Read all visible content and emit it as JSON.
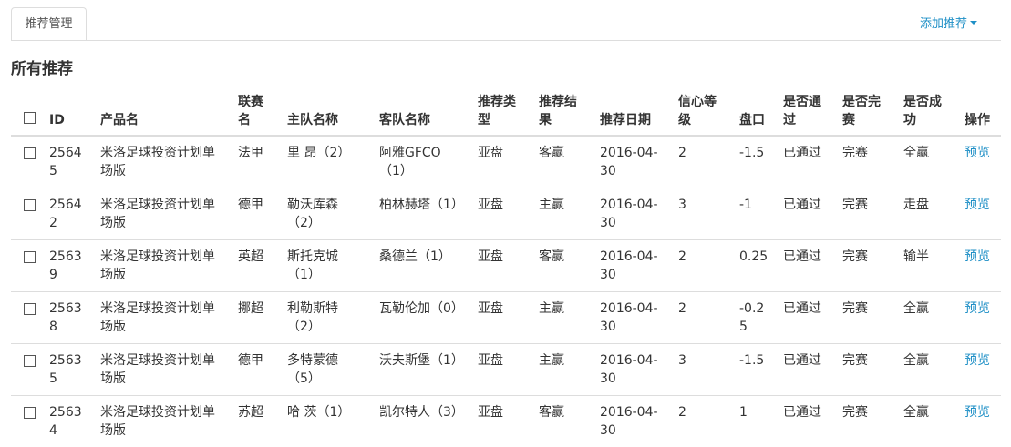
{
  "tabs": {
    "active_label": "推荐管理",
    "add_button_label": "添加推荐"
  },
  "page": {
    "title": "所有推荐"
  },
  "table": {
    "headers": {
      "id": "ID",
      "product": "产品名",
      "league": "联赛名",
      "home": "主队名称",
      "away": "客队名称",
      "rec_type": "推荐类型",
      "rec_result": "推荐结果",
      "rec_date": "推荐日期",
      "confidence": "信心等级",
      "handicap": "盘口",
      "approved": "是否通过",
      "finished": "是否完赛",
      "success": "是否成功",
      "action": "操作"
    },
    "rows": [
      {
        "id": "25645",
        "product": "米洛足球投资计划单场版",
        "league": "法甲",
        "home": "里 昂（2）",
        "away": "阿雅GFCO（1）",
        "rec_type": "亚盘",
        "rec_result": "客赢",
        "rec_date": "2016-04-30",
        "confidence": "2",
        "handicap": "-1.5",
        "approved": "已通过",
        "finished": "完赛",
        "success": "全赢",
        "action": "预览"
      },
      {
        "id": "25642",
        "product": "米洛足球投资计划单场版",
        "league": "德甲",
        "home": "勒沃库森（2）",
        "away": "柏林赫塔（1）",
        "rec_type": "亚盘",
        "rec_result": "主赢",
        "rec_date": "2016-04-30",
        "confidence": "3",
        "handicap": "-1",
        "approved": "已通过",
        "finished": "完赛",
        "success": "走盘",
        "action": "预览"
      },
      {
        "id": "25639",
        "product": "米洛足球投资计划单场版",
        "league": "英超",
        "home": "斯托克城（1）",
        "away": "桑德兰（1）",
        "rec_type": "亚盘",
        "rec_result": "客赢",
        "rec_date": "2016-04-30",
        "confidence": "2",
        "handicap": "0.25",
        "approved": "已通过",
        "finished": "完赛",
        "success": "输半",
        "action": "预览"
      },
      {
        "id": "25638",
        "product": "米洛足球投资计划单场版",
        "league": "挪超",
        "home": "利勒斯特（2）",
        "away": "瓦勒伦加（0）",
        "rec_type": "亚盘",
        "rec_result": "主赢",
        "rec_date": "2016-04-30",
        "confidence": "2",
        "handicap": "-0.25",
        "approved": "已通过",
        "finished": "完赛",
        "success": "全赢",
        "action": "预览"
      },
      {
        "id": "25635",
        "product": "米洛足球投资计划单场版",
        "league": "德甲",
        "home": "多特蒙德（5）",
        "away": "沃夫斯堡（1）",
        "rec_type": "亚盘",
        "rec_result": "主赢",
        "rec_date": "2016-04-30",
        "confidence": "3",
        "handicap": "-1.5",
        "approved": "已通过",
        "finished": "完赛",
        "success": "全赢",
        "action": "预览"
      },
      {
        "id": "25634",
        "product": "米洛足球投资计划单场版",
        "league": "苏超",
        "home": "哈 茨（1）",
        "away": "凯尔特人（3）",
        "rec_type": "亚盘",
        "rec_result": "客赢",
        "rec_date": "2016-04-30",
        "confidence": "2",
        "handicap": "1",
        "approved": "已通过",
        "finished": "完赛",
        "success": "全赢",
        "action": "预览"
      }
    ]
  }
}
